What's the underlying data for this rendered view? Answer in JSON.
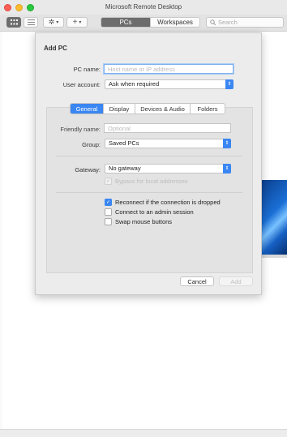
{
  "window": {
    "title": "Microsoft Remote Desktop"
  },
  "toolbar": {
    "tabs": [
      "PCs",
      "Workspaces"
    ],
    "search_placeholder": "Search",
    "icons": [
      "grid-view-icon",
      "list-view-icon",
      "gear-icon",
      "add-icon"
    ]
  },
  "dialog": {
    "title": "Add PC",
    "pc_name_label": "PC name:",
    "pc_name_placeholder": "Host name or IP address",
    "pc_name_value": "",
    "user_account_label": "User account:",
    "user_account_value": "Ask when required",
    "tabs": [
      "General",
      "Display",
      "Devices & Audio",
      "Folders"
    ],
    "selected_tab": "General",
    "friendly_name_label": "Friendly name:",
    "friendly_name_placeholder": "Optional",
    "group_label": "Group:",
    "group_value": "Saved PCs",
    "gateway_label": "Gateway:",
    "gateway_value": "No gateway",
    "bypass_label": "Bypass for local addresses",
    "bypass_checked": true,
    "bypass_enabled": false,
    "options": [
      {
        "label": "Reconnect if the connection is dropped",
        "checked": true
      },
      {
        "label": "Connect to an admin session",
        "checked": false
      },
      {
        "label": "Swap mouse buttons",
        "checked": false
      }
    ],
    "cancel_label": "Cancel",
    "add_label": "Add"
  },
  "colors": {
    "accent": "#3a86f2",
    "titlebar": "#e9e9e9",
    "sheet": "#ececec"
  }
}
